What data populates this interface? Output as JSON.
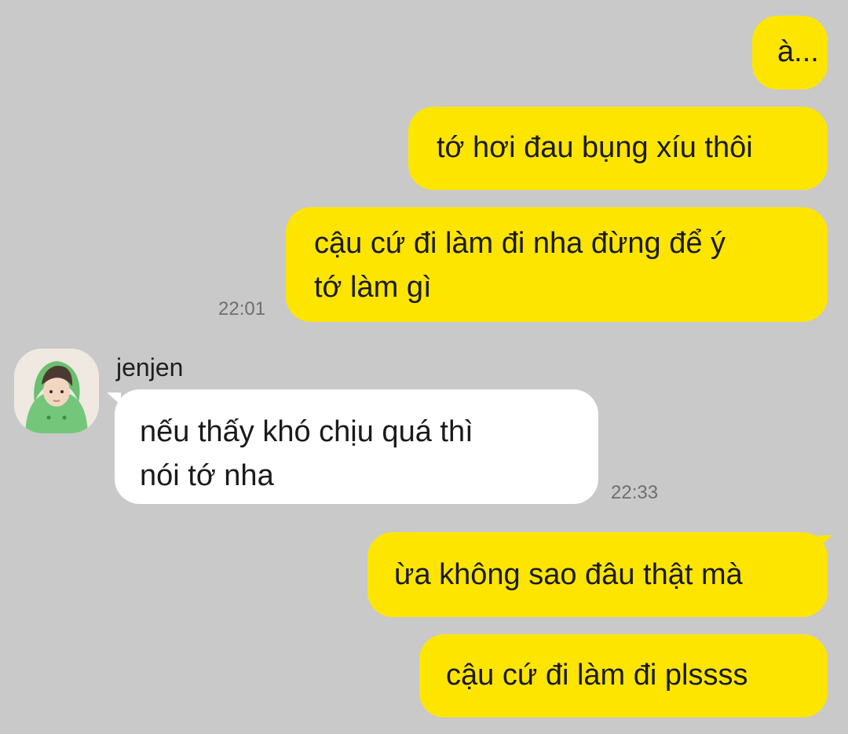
{
  "messages": [
    {
      "text": "à..."
    },
    {
      "text": "tớ hơi đau bụng xíu thôi"
    },
    {
      "line1": "cậu cứ đi làm đi nha đừng để ý",
      "line2": "tớ làm gì",
      "time": "22:01"
    },
    {
      "sender": "jenjen",
      "line1": "nếu thấy khó chịu quá thì",
      "line2": "nói tớ nha",
      "time": "22:33"
    },
    {
      "text": "ừa không sao đâu thật mà"
    },
    {
      "text": "cậu cứ đi làm đi plssss"
    }
  ],
  "colors": {
    "background": "#c9c9c9",
    "outgoing_bubble": "#fee500",
    "incoming_bubble": "#ffffff",
    "timestamp": "#6e6e6e"
  },
  "icons": {
    "avatar": "profile-photo"
  }
}
